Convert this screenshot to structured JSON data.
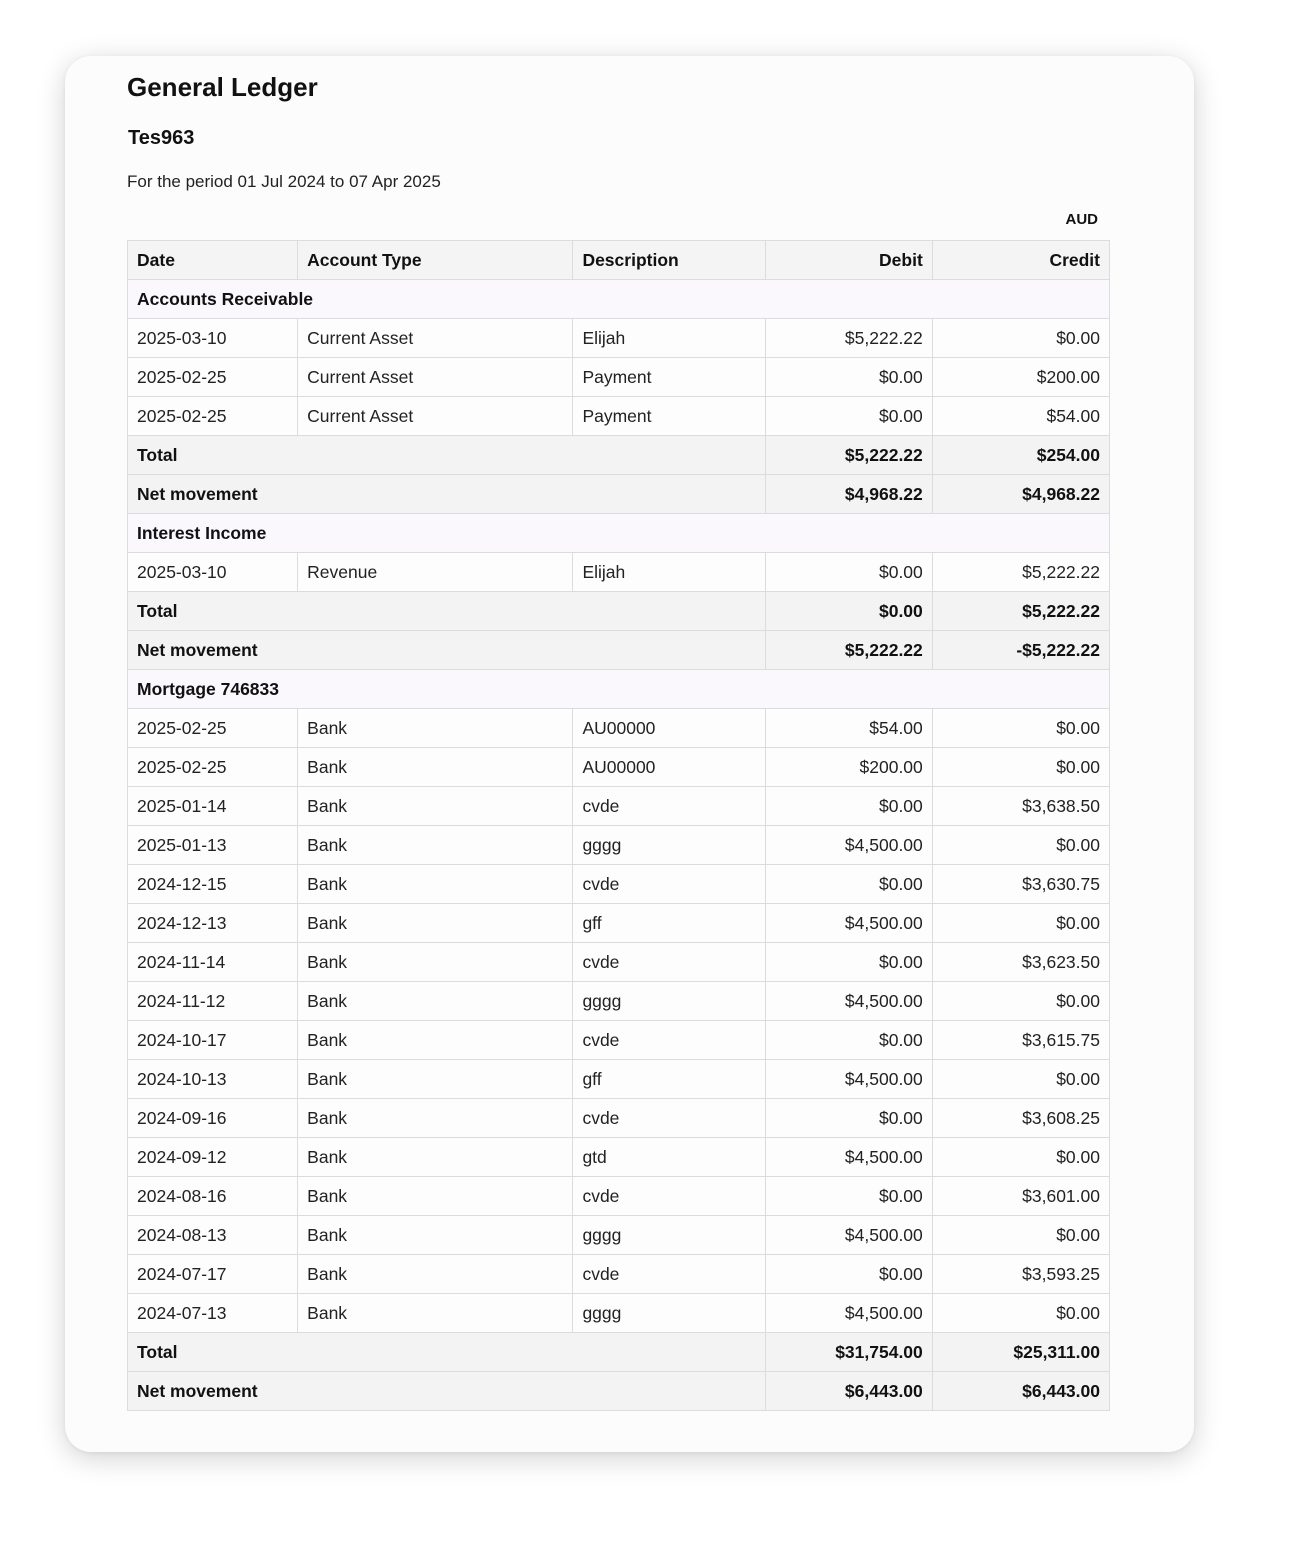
{
  "report": {
    "title": "General Ledger",
    "organisation": "Tes963",
    "period": "For the period 01 Jul 2024 to 07 Apr 2025",
    "currency": "AUD"
  },
  "table": {
    "columns": {
      "date": "Date",
      "account_type": "Account Type",
      "description": "Description",
      "debit": "Debit",
      "credit": "Credit"
    },
    "groups": [
      {
        "name": "Accounts Receivable",
        "rows": [
          {
            "date": "2025-03-10",
            "account_type": "Current Asset",
            "description": "Elijah",
            "debit": "$5,222.22",
            "credit": "$0.00"
          },
          {
            "date": "2025-02-25",
            "account_type": "Current Asset",
            "description": "Payment",
            "debit": "$0.00",
            "credit": "$200.00"
          },
          {
            "date": "2025-02-25",
            "account_type": "Current Asset",
            "description": "Payment",
            "debit": "$0.00",
            "credit": "$54.00"
          }
        ],
        "total": {
          "label": "Total",
          "debit": "$5,222.22",
          "credit": "$254.00"
        },
        "net": {
          "label": "Net movement",
          "debit": "$4,968.22",
          "credit": "$4,968.22"
        }
      },
      {
        "name": "Interest Income",
        "rows": [
          {
            "date": "2025-03-10",
            "account_type": "Revenue",
            "description": "Elijah",
            "debit": "$0.00",
            "credit": "$5,222.22"
          }
        ],
        "total": {
          "label": "Total",
          "debit": "$0.00",
          "credit": "$5,222.22"
        },
        "net": {
          "label": "Net movement",
          "debit": "$5,222.22",
          "credit": "-$5,222.22"
        }
      },
      {
        "name": "Mortgage 746833",
        "rows": [
          {
            "date": "2025-02-25",
            "account_type": "Bank",
            "description": "AU00000",
            "debit": "$54.00",
            "credit": "$0.00"
          },
          {
            "date": "2025-02-25",
            "account_type": "Bank",
            "description": "AU00000",
            "debit": "$200.00",
            "credit": "$0.00"
          },
          {
            "date": "2025-01-14",
            "account_type": "Bank",
            "description": "cvde",
            "debit": "$0.00",
            "credit": "$3,638.50"
          },
          {
            "date": "2025-01-13",
            "account_type": "Bank",
            "description": "gggg",
            "debit": "$4,500.00",
            "credit": "$0.00"
          },
          {
            "date": "2024-12-15",
            "account_type": "Bank",
            "description": "cvde",
            "debit": "$0.00",
            "credit": "$3,630.75"
          },
          {
            "date": "2024-12-13",
            "account_type": "Bank",
            "description": "gff",
            "debit": "$4,500.00",
            "credit": "$0.00"
          },
          {
            "date": "2024-11-14",
            "account_type": "Bank",
            "description": "cvde",
            "debit": "$0.00",
            "credit": "$3,623.50"
          },
          {
            "date": "2024-11-12",
            "account_type": "Bank",
            "description": "gggg",
            "debit": "$4,500.00",
            "credit": "$0.00"
          },
          {
            "date": "2024-10-17",
            "account_type": "Bank",
            "description": "cvde",
            "debit": "$0.00",
            "credit": "$3,615.75"
          },
          {
            "date": "2024-10-13",
            "account_type": "Bank",
            "description": "gff",
            "debit": "$4,500.00",
            "credit": "$0.00"
          },
          {
            "date": "2024-09-16",
            "account_type": "Bank",
            "description": "cvde",
            "debit": "$0.00",
            "credit": "$3,608.25"
          },
          {
            "date": "2024-09-12",
            "account_type": "Bank",
            "description": "gtd",
            "debit": "$4,500.00",
            "credit": "$0.00"
          },
          {
            "date": "2024-08-16",
            "account_type": "Bank",
            "description": "cvde",
            "debit": "$0.00",
            "credit": "$3,601.00"
          },
          {
            "date": "2024-08-13",
            "account_type": "Bank",
            "description": "gggg",
            "debit": "$4,500.00",
            "credit": "$0.00"
          },
          {
            "date": "2024-07-17",
            "account_type": "Bank",
            "description": "cvde",
            "debit": "$0.00",
            "credit": "$3,593.25"
          },
          {
            "date": "2024-07-13",
            "account_type": "Bank",
            "description": "gggg",
            "debit": "$4,500.00",
            "credit": "$0.00"
          }
        ],
        "total": {
          "label": "Total",
          "debit": "$31,754.00",
          "credit": "$25,311.00"
        },
        "net": {
          "label": "Net movement",
          "debit": "$6,443.00",
          "credit": "$6,443.00"
        }
      }
    ]
  }
}
